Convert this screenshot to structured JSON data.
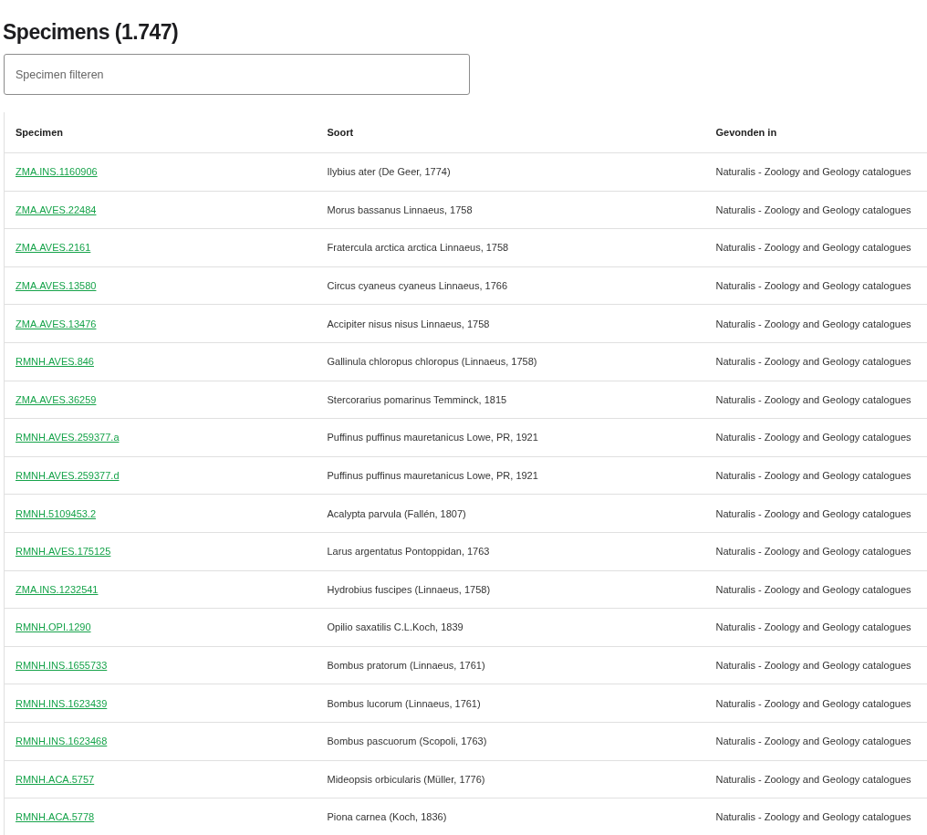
{
  "title": "Specimens (1.747)",
  "filter": {
    "placeholder": "Specimen filteren"
  },
  "table": {
    "columns": [
      "Specimen",
      "Soort",
      "Gevonden in"
    ],
    "rows": [
      {
        "specimen": "ZMA.INS.1160906",
        "soort": "Ilybius ater (De Geer, 1774)",
        "gevonden_in": "Naturalis - Zoology and Geology catalogues"
      },
      {
        "specimen": "ZMA.AVES.22484",
        "soort": "Morus bassanus Linnaeus, 1758",
        "gevonden_in": "Naturalis - Zoology and Geology catalogues"
      },
      {
        "specimen": "ZMA.AVES.2161",
        "soort": "Fratercula arctica arctica Linnaeus, 1758",
        "gevonden_in": "Naturalis - Zoology and Geology catalogues"
      },
      {
        "specimen": "ZMA.AVES.13580",
        "soort": "Circus cyaneus cyaneus Linnaeus, 1766",
        "gevonden_in": "Naturalis - Zoology and Geology catalogues"
      },
      {
        "specimen": "ZMA.AVES.13476",
        "soort": "Accipiter nisus nisus Linnaeus, 1758",
        "gevonden_in": "Naturalis - Zoology and Geology catalogues"
      },
      {
        "specimen": "RMNH.AVES.846",
        "soort": "Gallinula chloropus chloropus (Linnaeus, 1758)",
        "gevonden_in": "Naturalis - Zoology and Geology catalogues"
      },
      {
        "specimen": "ZMA.AVES.36259",
        "soort": "Stercorarius pomarinus Temminck, 1815",
        "gevonden_in": "Naturalis - Zoology and Geology catalogues"
      },
      {
        "specimen": "RMNH.AVES.259377.a",
        "soort": "Puffinus puffinus mauretanicus Lowe, PR, 1921",
        "gevonden_in": "Naturalis - Zoology and Geology catalogues"
      },
      {
        "specimen": "RMNH.AVES.259377.d",
        "soort": "Puffinus puffinus mauretanicus Lowe, PR, 1921",
        "gevonden_in": "Naturalis - Zoology and Geology catalogues"
      },
      {
        "specimen": "RMNH.5109453.2",
        "soort": "Acalypta parvula (Fallén, 1807)",
        "gevonden_in": "Naturalis - Zoology and Geology catalogues"
      },
      {
        "specimen": "RMNH.AVES.175125",
        "soort": "Larus argentatus Pontoppidan, 1763",
        "gevonden_in": "Naturalis - Zoology and Geology catalogues"
      },
      {
        "specimen": "ZMA.INS.1232541",
        "soort": "Hydrobius fuscipes (Linnaeus, 1758)",
        "gevonden_in": "Naturalis - Zoology and Geology catalogues"
      },
      {
        "specimen": "RMNH.OPI.1290",
        "soort": "Opilio saxatilis C.L.Koch, 1839",
        "gevonden_in": "Naturalis - Zoology and Geology catalogues"
      },
      {
        "specimen": "RMNH.INS.1655733",
        "soort": "Bombus pratorum (Linnaeus, 1761)",
        "gevonden_in": "Naturalis - Zoology and Geology catalogues"
      },
      {
        "specimen": "RMNH.INS.1623439",
        "soort": "Bombus lucorum (Linnaeus, 1761)",
        "gevonden_in": "Naturalis - Zoology and Geology catalogues"
      },
      {
        "specimen": "RMNH.INS.1623468",
        "soort": "Bombus pascuorum (Scopoli, 1763)",
        "gevonden_in": "Naturalis - Zoology and Geology catalogues"
      },
      {
        "specimen": "RMNH.ACA.5757",
        "soort": "Mideopsis orbicularis (Müller, 1776)",
        "gevonden_in": "Naturalis - Zoology and Geology catalogues"
      },
      {
        "specimen": "RMNH.ACA.5778",
        "soort": "Piona carnea (Koch, 1836)",
        "gevonden_in": "Naturalis - Zoology and Geology catalogues"
      }
    ]
  }
}
